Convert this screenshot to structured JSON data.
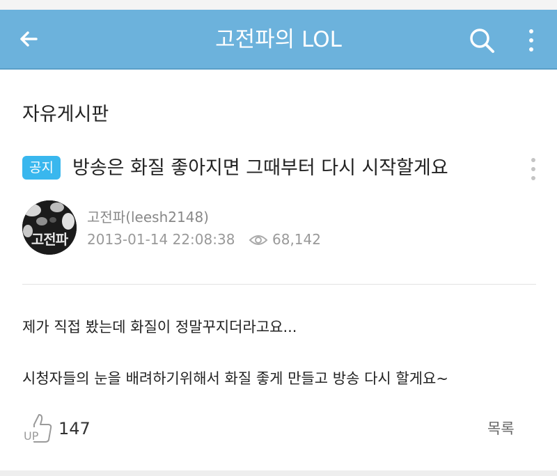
{
  "header": {
    "title": "고전파의 LOL",
    "back_icon": "arrow-left-icon",
    "search_icon": "search-icon",
    "more_icon": "more-vertical-icon",
    "bar_color": "#6cb2dc"
  },
  "board": {
    "title": "자유게시판"
  },
  "post": {
    "badge": "공지",
    "badge_color": "#39b7ee",
    "title": "방송은 화질 좋아지면 그때부터 다시 시작할게요",
    "author": {
      "name": "고전파(leesh2148)",
      "avatar_text": "고전파"
    },
    "date": "2013-01-14 22:08:38",
    "views": "68,142",
    "body": [
      "제가 직접 봤는데 화질이 정말꾸지더라고요...",
      "시청자들의 눈을 배려하기위해서 화질 좋게 만들고 방송 다시 할게요~"
    ],
    "likes": "147",
    "list_label": "목록"
  }
}
